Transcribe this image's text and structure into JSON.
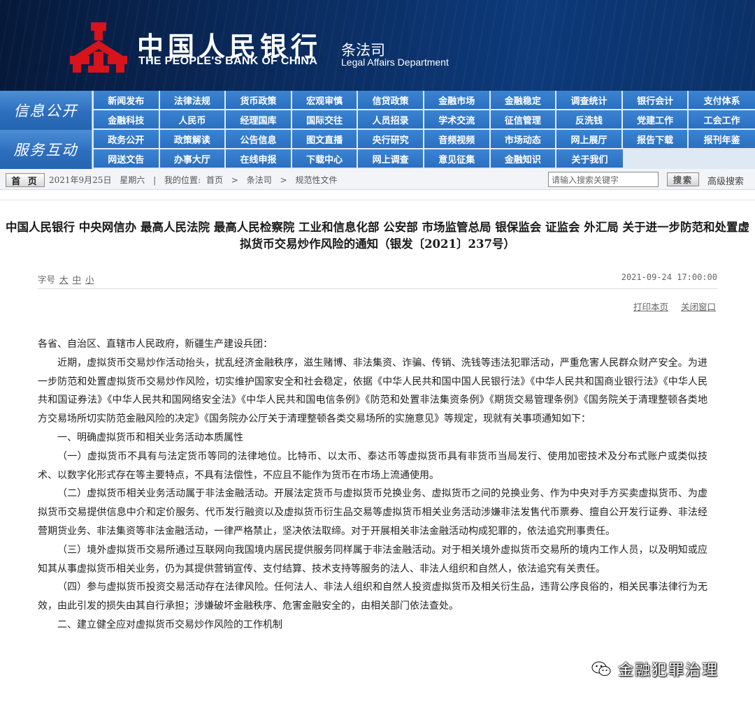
{
  "header": {
    "bank_name_cn": "中国人民银行",
    "bank_name_en": "THE PEOPLE'S BANK OF CHINA",
    "dept_cn": "条法司",
    "dept_en": "Legal Affairs Department",
    "emblem_color": "#d7131b"
  },
  "nav": {
    "row1_title": "信息公开",
    "row1_items": [
      "新闻发布",
      "法律法规",
      "货币政策",
      "宏观审慎",
      "信贷政策",
      "金融市场",
      "金融稳定",
      "调查统计",
      "银行会计",
      "支付体系",
      "金融科技",
      "人民币",
      "经理国库",
      "国际交往",
      "人员招录",
      "学术交流",
      "征信管理",
      "反洗钱",
      "党建工作",
      "工会工作"
    ],
    "row2_title": "服务互动",
    "row2_items": [
      "政务公开",
      "政策解读",
      "公告信息",
      "图文直播",
      "央行研究",
      "音频视频",
      "市场动态",
      "网上展厅",
      "报告下载",
      "报刊年鉴",
      "网送文告",
      "办事大厅",
      "在线申报",
      "下载中心",
      "网上调查",
      "意见征集",
      "金融知识",
      "关于我们"
    ]
  },
  "infobar": {
    "home_label": "首 页",
    "date": "2021年9月25日",
    "weekday": "星期六",
    "location_label": "我的位置:",
    "crumbs": [
      "首页",
      "条法司",
      "规范性文件"
    ],
    "crumb_separator": ">",
    "search_placeholder": "请输入搜索关键字",
    "search_button": "搜索",
    "advanced_search": "高级搜索"
  },
  "article": {
    "title": "中国人民银行 中央网信办 最高人民法院 最高人民检察院 工业和信息化部 公安部 市场监管总局 银保监会 证监会 外汇局 关于进一步防范和处置虚拟货币交易炒作风险的通知（银发〔2021〕237号）",
    "font_size_label": "字号",
    "font_sizes": [
      "大",
      "中",
      "小"
    ],
    "publish_time": "2021-09-24 17:00:00",
    "print_label": "打印本页",
    "close_label": "关闭窗口",
    "paragraphs": [
      {
        "text": "各省、自治区、直辖市人民政府，新疆生产建设兵团：",
        "indent": false
      },
      {
        "text": "近期，虚拟货币交易炒作活动抬头，扰乱经济金融秩序，滋生赌博、非法集资、诈骗、传销、洗钱等违法犯罪活动，严重危害人民群众财产安全。为进一步防范和处置虚拟货币交易炒作风险，切实维护国家安全和社会稳定，依据《中华人民共和国中国人民银行法》《中华人民共和国商业银行法》《中华人民共和国证券法》《中华人民共和国网络安全法》《中华人民共和国电信条例》《防范和处置非法集资条例》《期货交易管理条例》《国务院关于清理整顿各类地方交易场所切实防范金融风险的决定》《国务院办公厅关于清理整顿各类交易场所的实施意见》等规定，现就有关事项通知如下：",
        "indent": true
      },
      {
        "text": "一、明确虚拟货币和相关业务活动本质属性",
        "indent": true
      },
      {
        "text": "（一）虚拟货币不具有与法定货币等同的法律地位。比特币、以太币、泰达币等虚拟货币具有非货币当局发行、使用加密技术及分布式账户或类似技术、以数字化形式存在等主要特点，不具有法偿性，不应且不能作为货币在市场上流通使用。",
        "indent": true
      },
      {
        "text": "（二）虚拟货币相关业务活动属于非法金融活动。开展法定货币与虚拟货币兑换业务、虚拟货币之间的兑换业务、作为中央对手方买卖虚拟货币、为虚拟货币交易提供信息中介和定价服务、代币发行融资以及虚拟货币衍生品交易等虚拟货币相关业务活动涉嫌非法发售代币票券、擅自公开发行证券、非法经营期货业务、非法集资等非法金融活动，一律严格禁止，坚决依法取缔。对于开展相关非法金融活动构成犯罪的，依法追究刑事责任。",
        "indent": true
      },
      {
        "text": "（三）境外虚拟货币交易所通过互联网向我国境内居民提供服务同样属于非法金融活动。对于相关境外虚拟货币交易所的境内工作人员，以及明知或应知其从事虚拟货币相关业务，仍为其提供营销宣传、支付结算、技术支持等服务的法人、非法人组织和自然人，依法追究有关责任。",
        "indent": true
      },
      {
        "text": "（四）参与虚拟货币投资交易活动存在法律风险。任何法人、非法人组织和自然人投资虚拟货币及相关衍生品，违背公序良俗的，相关民事法律行为无效，由此引发的损失由其自行承担；涉嫌破坏金融秩序、危害金融安全的，由相关部门依法查处。",
        "indent": true
      },
      {
        "text": "二、建立健全应对虚拟货币交易炒作风险的工作机制",
        "indent": true
      }
    ]
  },
  "watermark": {
    "text": "金融犯罪治理",
    "icon": "wechat-icon"
  }
}
